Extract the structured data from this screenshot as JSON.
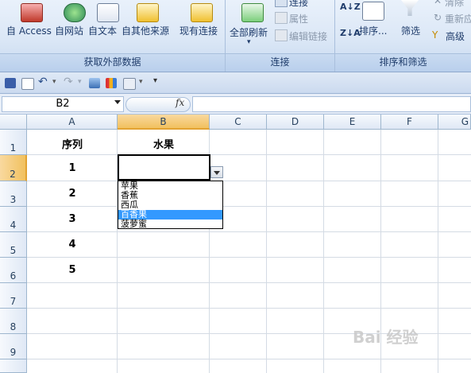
{
  "ribbon": {
    "groups": {
      "external": {
        "footer": "获取外部数据",
        "buttons": [
          "自 Access",
          "自网站",
          "自文本",
          "自其他来源"
        ],
        "existing_connections": "现有连接"
      },
      "connections": {
        "footer": "连接",
        "refresh_all": "全部刷新",
        "connections": "连接",
        "properties": "属性",
        "edit_links": "编辑链接"
      },
      "sort_filter": {
        "footer": "排序和筛选",
        "sort": "排序...",
        "filter": "筛选",
        "clear": "清除",
        "reapply": "重新应用",
        "advanced": "高级"
      }
    }
  },
  "formula_bar": {
    "name_box": "B2",
    "fx": "fx",
    "value": ""
  },
  "columns": [
    "A",
    "B",
    "C",
    "D",
    "E",
    "F",
    "G"
  ],
  "rows": [
    "1",
    "2",
    "3",
    "4",
    "5",
    "6",
    "7",
    "8",
    "9"
  ],
  "cells": {
    "A1": "序列",
    "B1": "水果",
    "A2": "1",
    "A3": "2",
    "A4": "3",
    "A5": "4",
    "A6": "5"
  },
  "dropdown": {
    "options": [
      "苹果",
      "香蕉",
      "西瓜",
      "百香果",
      "菠萝蜜"
    ],
    "highlighted_index": 3
  },
  "watermark": "Bai 经验"
}
